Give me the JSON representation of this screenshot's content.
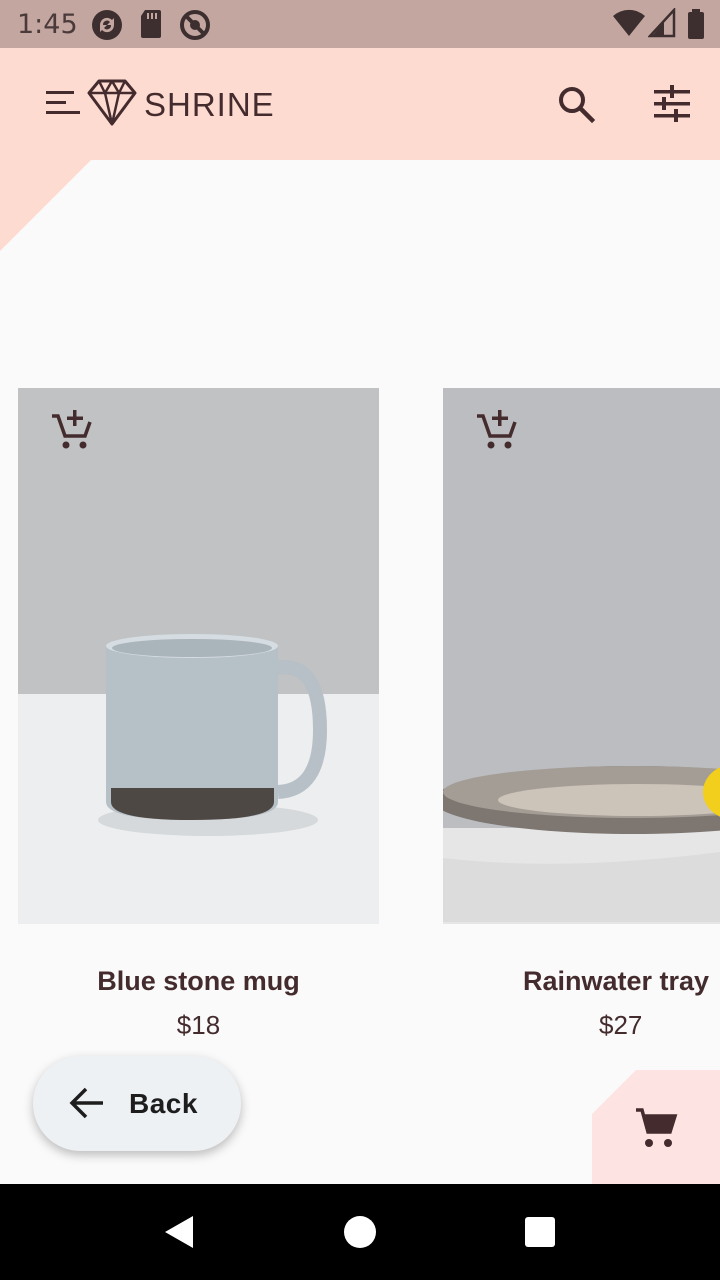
{
  "status_bar": {
    "time": "1:45",
    "icons": [
      "sync-icon",
      "sd-card-icon",
      "no-signal-icon",
      "wifi-icon",
      "cell-signal-icon",
      "battery-icon"
    ]
  },
  "app_bar": {
    "brand": "SHRINE",
    "icons": [
      "menu-icon",
      "diamond-logo-icon",
      "search-icon",
      "tune-filter-icon"
    ],
    "color": "#fedbd0"
  },
  "products": [
    {
      "name": "Blue stone mug",
      "price": "$18",
      "image": "blue-stone-mug-photo"
    },
    {
      "name": "Rainwater tray",
      "price": "$27",
      "image": "rainwater-tray-photo"
    }
  ],
  "back_button": {
    "label": "Back"
  },
  "cart": {
    "icon": "shopping-cart-icon"
  },
  "colors": {
    "background": "#fafafa",
    "text": "#442c2e",
    "accent_pink": "#fedbd0"
  }
}
